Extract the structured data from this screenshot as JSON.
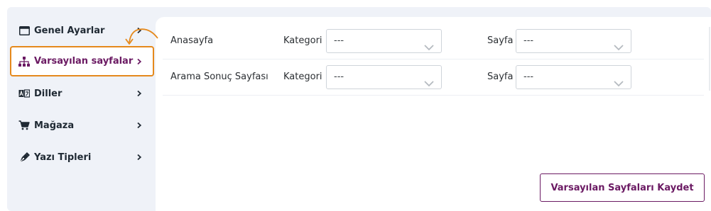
{
  "sidebar": {
    "items": [
      {
        "label": "Genel Ayarlar",
        "icon": "window-icon"
      },
      {
        "label": "Varsayılan sayfalar",
        "icon": "sitemap-icon",
        "active": true
      },
      {
        "label": "Diller",
        "icon": "language-icon"
      },
      {
        "label": "Mağaza",
        "icon": "cart-icon"
      },
      {
        "label": "Yazı Tipleri",
        "icon": "pen-nib-icon"
      }
    ]
  },
  "rows": [
    {
      "title": "Anasayfa",
      "category_label": "Kategori",
      "category_value": "---",
      "page_label": "Sayfa",
      "page_value": "---"
    },
    {
      "title": "Arama Sonuç Sayfası",
      "category_label": "Kategori",
      "category_value": "---",
      "page_label": "Sayfa",
      "page_value": "---"
    }
  ],
  "save_button": {
    "label": "Varsayılan Sayfaları Kaydet"
  },
  "colors": {
    "accent": "#6b1a63",
    "highlight": "#e5891c",
    "sidebar_bg": "#eff2f8"
  }
}
